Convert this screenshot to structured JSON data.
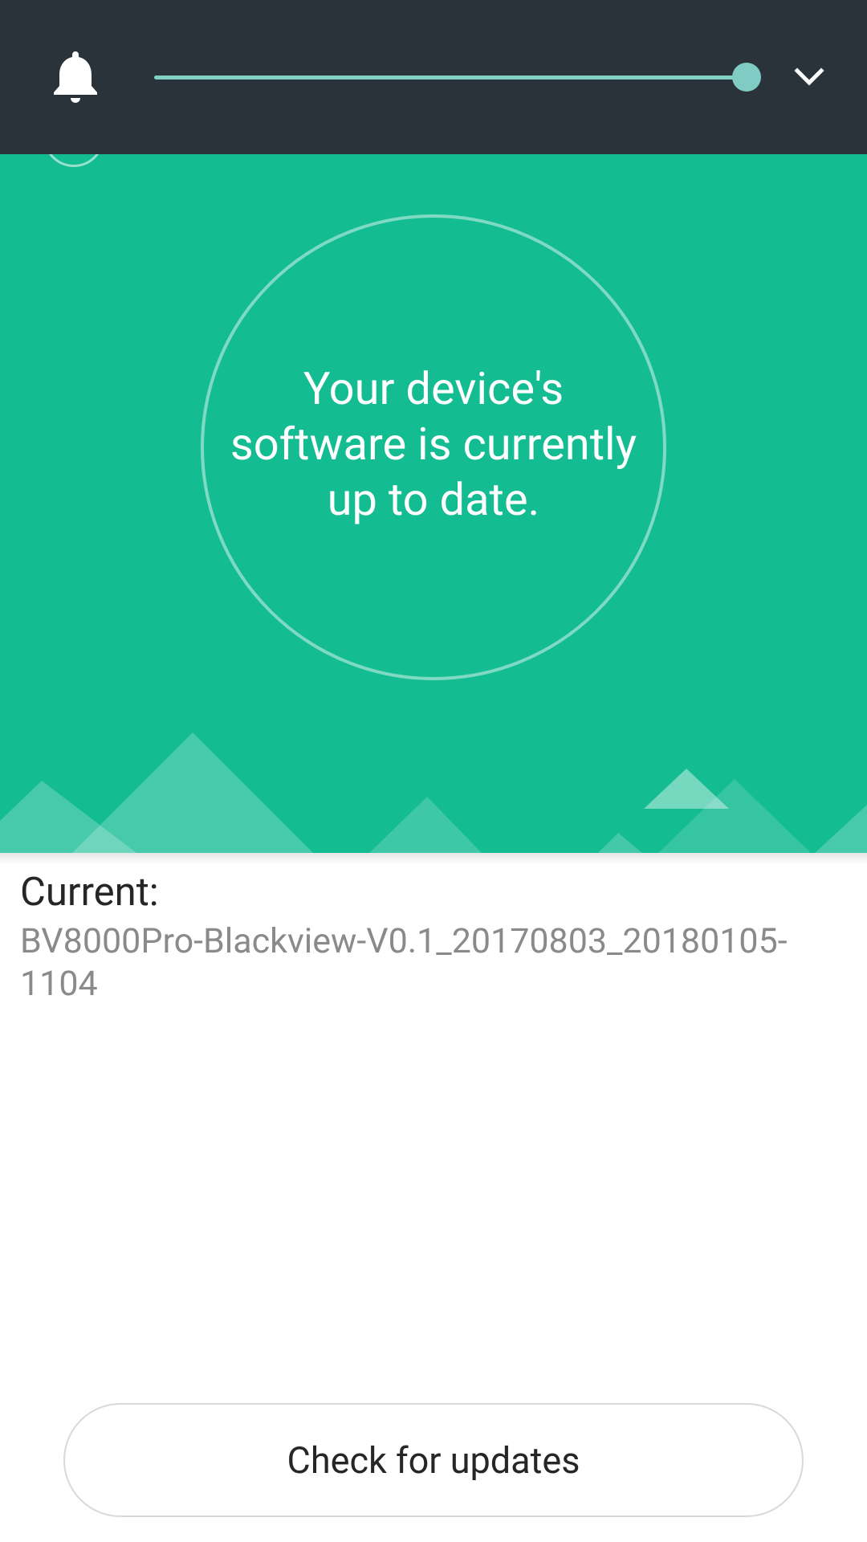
{
  "top_bar": {
    "bell_icon": "bell-icon",
    "slider_value": 1.0,
    "slider_color": "#80cbc4",
    "collapse_icon": "chevron-down-icon"
  },
  "hero": {
    "background_color": "#14bc92",
    "status_text": "Your device's software is currently up to date."
  },
  "current": {
    "label": "Current:",
    "version": "BV8000Pro-Blackview-V0.1_20170803_20180105-1104"
  },
  "actions": {
    "check_label": "Check for updates"
  }
}
